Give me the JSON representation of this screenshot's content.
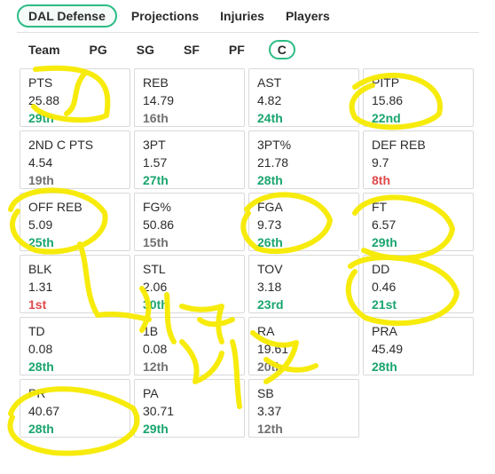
{
  "top_tabs": [
    {
      "label": "DAL Defense",
      "active": true
    },
    {
      "label": "Projections",
      "active": false
    },
    {
      "label": "Injuries",
      "active": false
    },
    {
      "label": "Players",
      "active": false
    }
  ],
  "position_tabs": [
    {
      "label": "Team",
      "active": false
    },
    {
      "label": "PG",
      "active": false
    },
    {
      "label": "SG",
      "active": false
    },
    {
      "label": "SF",
      "active": false
    },
    {
      "label": "PF",
      "active": false
    },
    {
      "label": "C",
      "active": true
    }
  ],
  "stats": [
    {
      "label": "PTS",
      "value": "25.88",
      "rank": "29th",
      "tone": "good"
    },
    {
      "label": "REB",
      "value": "14.79",
      "rank": "16th",
      "tone": "mid"
    },
    {
      "label": "AST",
      "value": "4.82",
      "rank": "24th",
      "tone": "good"
    },
    {
      "label": "PITP",
      "value": "15.86",
      "rank": "22nd",
      "tone": "good"
    },
    {
      "label": "2ND C PTS",
      "value": "4.54",
      "rank": "19th",
      "tone": "mid"
    },
    {
      "label": "3PT",
      "value": "1.57",
      "rank": "27th",
      "tone": "good"
    },
    {
      "label": "3PT%",
      "value": "21.78",
      "rank": "28th",
      "tone": "good"
    },
    {
      "label": "DEF REB",
      "value": "9.7",
      "rank": "8th",
      "tone": "bad"
    },
    {
      "label": "OFF REB",
      "value": "5.09",
      "rank": "25th",
      "tone": "good"
    },
    {
      "label": "FG%",
      "value": "50.86",
      "rank": "15th",
      "tone": "mid"
    },
    {
      "label": "FGA",
      "value": "9.73",
      "rank": "26th",
      "tone": "good"
    },
    {
      "label": "FT",
      "value": "6.57",
      "rank": "29th",
      "tone": "good"
    },
    {
      "label": "BLK",
      "value": "1.31",
      "rank": "1st",
      "tone": "bad"
    },
    {
      "label": "STL",
      "value": "2.06",
      "rank": "30th",
      "tone": "good"
    },
    {
      "label": "TOV",
      "value": "3.18",
      "rank": "23rd",
      "tone": "good"
    },
    {
      "label": "DD",
      "value": "0.46",
      "rank": "21st",
      "tone": "good"
    },
    {
      "label": "TD",
      "value": "0.08",
      "rank": "28th",
      "tone": "good"
    },
    {
      "label": "1B",
      "value": "0.08",
      "rank": "12th",
      "tone": "mid"
    },
    {
      "label": "RA",
      "value": "19.61",
      "rank": "20th",
      "tone": "mid"
    },
    {
      "label": "PRA",
      "value": "45.49",
      "rank": "28th",
      "tone": "good"
    },
    {
      "label": "PR",
      "value": "40.67",
      "rank": "28th",
      "tone": "good"
    },
    {
      "label": "PA",
      "value": "30.71",
      "rank": "29th",
      "tone": "good"
    },
    {
      "label": "SB",
      "value": "3.37",
      "rank": "12th",
      "tone": "mid"
    }
  ],
  "colors": {
    "accent": "#2bbd85",
    "rank_good": "#1aa56e",
    "rank_mid": "#707070",
    "rank_bad": "#e0494a",
    "highlighter": "#f7ea00"
  }
}
